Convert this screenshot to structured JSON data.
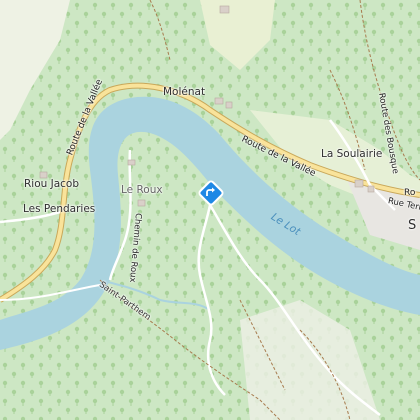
{
  "map": {
    "places": {
      "molenat": "Molénat",
      "la_soulairie": "La Soulairie",
      "riou_jacob": "Riou Jacob",
      "les_pendaries": "Les Pendaries",
      "le_roux": "Le Roux",
      "saint_parthem": "Saint-Parthem",
      "edge_s": "S"
    },
    "water": {
      "le_lot": "Le Lot"
    },
    "roads": {
      "route_vallee_left": "Route de la Vallée",
      "route_vallee_right": "Route de la Vallée",
      "route_edge": "Ro",
      "chemin_roux": "Chemin de Roux",
      "rue_terre": "Rue Terre",
      "route_bousquet": "Route des Bousque"
    },
    "marker": {
      "icon": "directions-icon",
      "color": "#1e88e5"
    },
    "colors": {
      "forest": "#cde7c4",
      "river": "#aad3df",
      "road_major": "#f9e39a",
      "road_casing": "#c9a85a",
      "clearing": "#e6f0d6"
    }
  }
}
